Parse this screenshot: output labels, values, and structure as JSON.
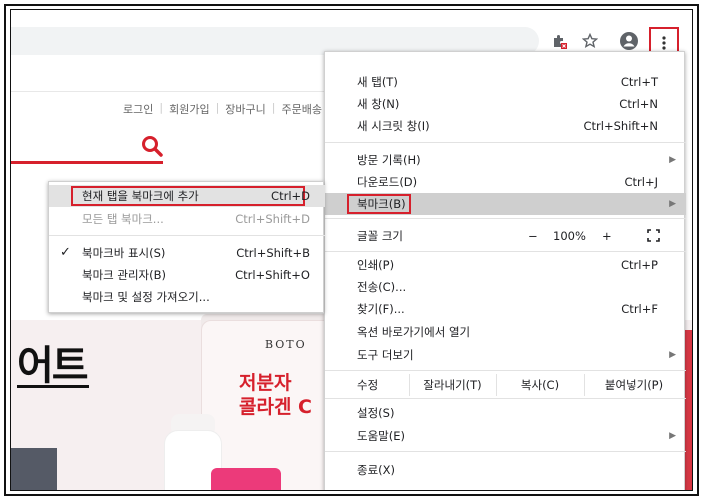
{
  "toolbar": {
    "icons": [
      "extension-icon",
      "star-icon",
      "profile-icon",
      "kebab-menu-icon"
    ]
  },
  "page": {
    "util_links": [
      "로그인",
      "회원가입",
      "장바구니",
      "주문배송"
    ],
    "headline": "어트",
    "product": {
      "brand": "BOTO",
      "name_line1": "저분자",
      "name_line2": "콜라겐 C"
    }
  },
  "main_menu": {
    "new_tab": {
      "label": "새 탭(T)",
      "shortcut": "Ctrl+T"
    },
    "new_window": {
      "label": "새 창(N)",
      "shortcut": "Ctrl+N"
    },
    "incognito": {
      "label": "새 시크릿 창(I)",
      "shortcut": "Ctrl+Shift+N"
    },
    "history": {
      "label": "방문 기록(H)"
    },
    "downloads": {
      "label": "다운로드(D)",
      "shortcut": "Ctrl+J"
    },
    "bookmarks": {
      "label": "북마크(B)"
    },
    "zoom": {
      "label": "글꼴 크기",
      "minus": "−",
      "value": "100%",
      "plus": "+"
    },
    "print": {
      "label": "인쇄(P)",
      "shortcut": "Ctrl+P"
    },
    "cast": {
      "label": "전송(C)..."
    },
    "find": {
      "label": "찾기(F)...",
      "shortcut": "Ctrl+F"
    },
    "shortcut_open": {
      "label": "옥션 바로가기에서 열기"
    },
    "more_tools": {
      "label": "도구 더보기"
    },
    "edit": {
      "label": "수정",
      "cut": "잘라내기(T)",
      "copy": "복사(C)",
      "paste": "붙여넣기(P)"
    },
    "settings": {
      "label": "설정(S)"
    },
    "help": {
      "label": "도움말(E)"
    },
    "exit": {
      "label": "종료(X)"
    }
  },
  "bookmark_submenu": {
    "add_current": {
      "label": "현재 탭을 북마크에 추가",
      "shortcut": "Ctrl+D"
    },
    "bookmark_all": {
      "label": "모든 탭 북마크...",
      "shortcut": "Ctrl+Shift+D"
    },
    "show_bar": {
      "label": "북마크바 표시(S)",
      "shortcut": "Ctrl+Shift+B",
      "checked": true
    },
    "manager": {
      "label": "북마크 관리자(B)",
      "shortcut": "Ctrl+Shift+O"
    },
    "import": {
      "label": "북마크 및 설정 가져오기..."
    }
  },
  "colors": {
    "accent_red": "#d6202c",
    "menu_highlight": "#cfcfcf"
  }
}
